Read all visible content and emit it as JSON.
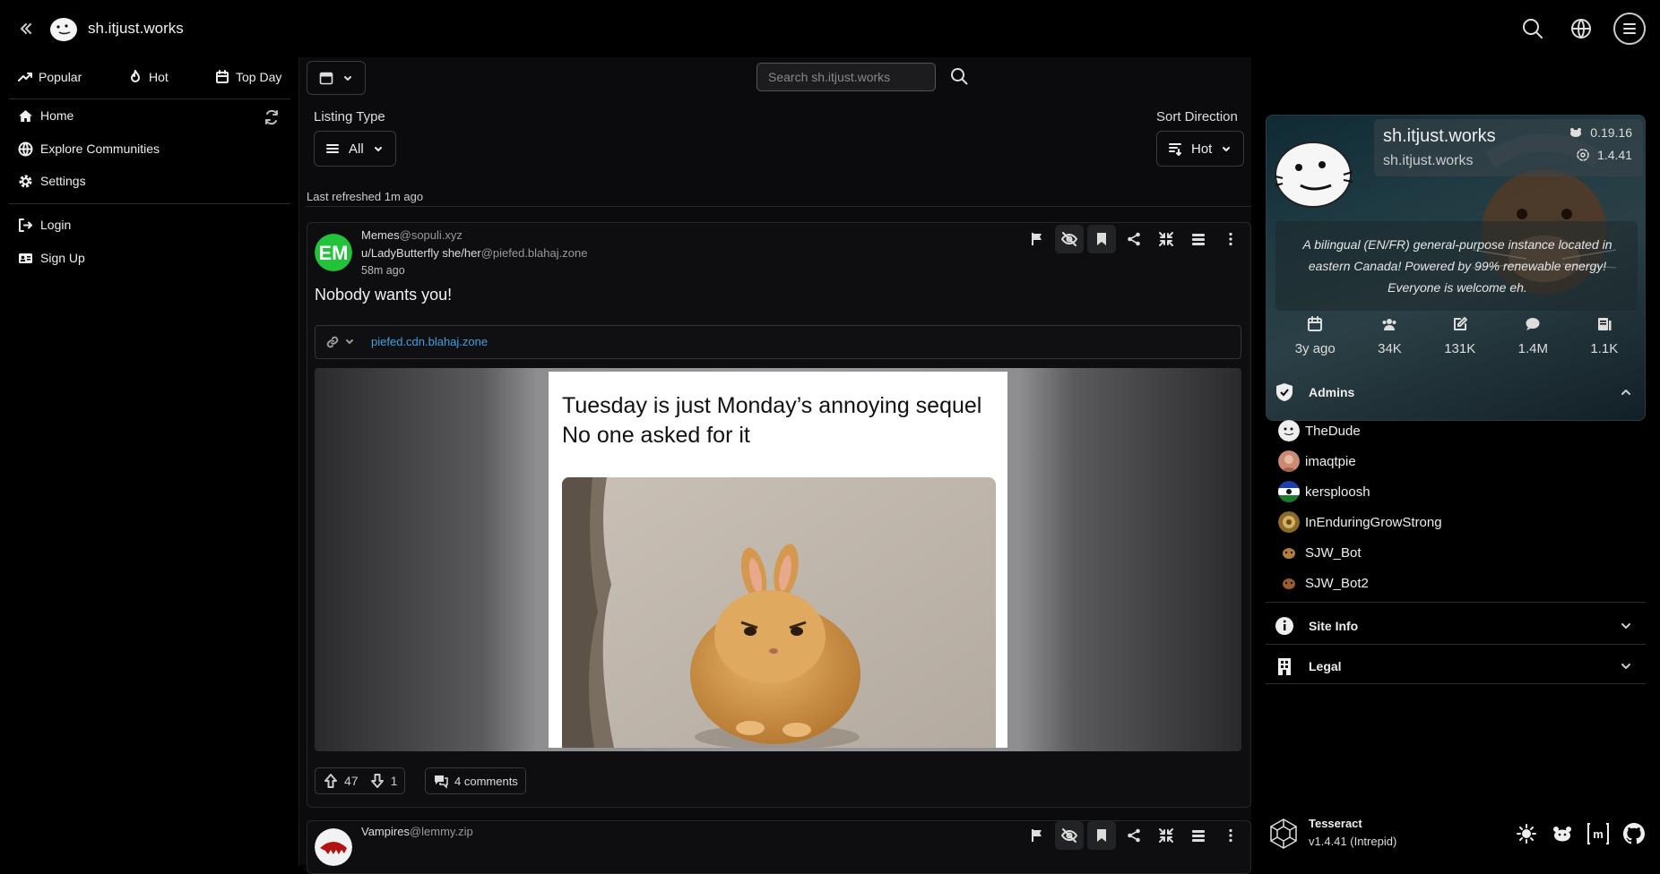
{
  "topbar": {
    "site_name": "sh.itjust.works",
    "icons": [
      "collapse-icon",
      "search-icon",
      "globe-icon",
      "menu-icon"
    ]
  },
  "sidebar": {
    "quick": [
      {
        "label": "Popular",
        "icon": "trending-icon"
      },
      {
        "label": "Hot",
        "icon": "flame-icon"
      },
      {
        "label": "Top Day",
        "icon": "calendar-icon"
      }
    ],
    "nav": [
      {
        "label": "Home",
        "icon": "home-icon"
      },
      {
        "label": "Explore Communities",
        "icon": "globe-icon"
      },
      {
        "label": "Settings",
        "icon": "gear-icon"
      }
    ],
    "auth": [
      {
        "label": "Login",
        "icon": "login-icon"
      },
      {
        "label": "Sign Up",
        "icon": "id-card-icon"
      }
    ]
  },
  "main": {
    "search": {
      "placeholder": "Search sh.itjust.works"
    },
    "listing_type": {
      "label": "Listing Type",
      "value": "All"
    },
    "sort_direction": {
      "label": "Sort Direction",
      "value": "Hot"
    },
    "last_refreshed": "Last refreshed 1m ago",
    "posts": [
      {
        "community": "Memes",
        "community_instance": "@sopuli.xyz",
        "author": "u/LadyButterfly she/her",
        "author_instance": "@piefed.blahaj.zone",
        "time": "58m ago",
        "title": "Nobody wants you!",
        "link": "piefed.cdn.blahaj.zone",
        "meme_text": "Tuesday is just Monday’s annoying sequel\nNo one asked for it",
        "upvotes": "47",
        "downvotes": "1",
        "comments": "4 comments"
      },
      {
        "community": "Vampires",
        "community_instance": "@lemmy.zip"
      }
    ]
  },
  "site_card": {
    "name": "sh.itjust.works",
    "domain": "sh.itjust.works",
    "lemmy_version": "0.19.16",
    "ui_version": "1.4.41",
    "description": "A bilingual (EN/FR) general-purpose instance located in eastern Canada! Powered by 99% renewable energy! Everyone is welcome eh.",
    "stats": [
      {
        "icon": "calendar-icon",
        "value": "3y ago"
      },
      {
        "icon": "users-icon",
        "value": "34K"
      },
      {
        "icon": "edit-icon",
        "value": "131K"
      },
      {
        "icon": "chat-icon",
        "value": "1.4M"
      },
      {
        "icon": "community-icon",
        "value": "1.1K"
      }
    ]
  },
  "admins": {
    "label": "Admins",
    "list": [
      "TheDude",
      "imaqtpie",
      "kersploosh",
      "InEnduringGrowStrong",
      "SJW_Bot",
      "SJW_Bot2"
    ]
  },
  "site_info": {
    "label": "Site Info"
  },
  "legal": {
    "label": "Legal"
  },
  "footer": {
    "name": "Tesseract",
    "version": "v1.4.41 (Intrepid)"
  },
  "colors": {
    "accent_link": "#3fa2e0",
    "background": "#000000",
    "card": "#0e0e10"
  }
}
